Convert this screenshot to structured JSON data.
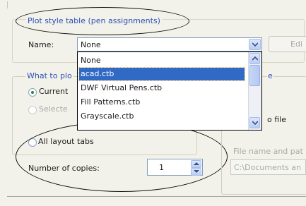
{
  "plot_style_group": {
    "title": "Plot style table (pen assignments)",
    "name_label": "Name:",
    "name_value": "None",
    "edit_button": "Edi"
  },
  "dropdown": {
    "options": [
      "None",
      "acad.ctb",
      "DWF Virtual Pens.ctb",
      "Fill Patterns.ctb",
      "Grayscale.ctb"
    ],
    "selected_index": 1
  },
  "what_to_plot": {
    "title_visible": "What to plo",
    "current_label": "Current",
    "selected_label": "Selecte",
    "all_layout_label": "All layout tabs",
    "copies_label": "Number of copies:",
    "copies_value": "1"
  },
  "right_panel": {
    "title_fragment": "e",
    "to_file_label": "o file",
    "file_name_label": "File name and pat",
    "file_path_value": "C:\\Documents an"
  }
}
